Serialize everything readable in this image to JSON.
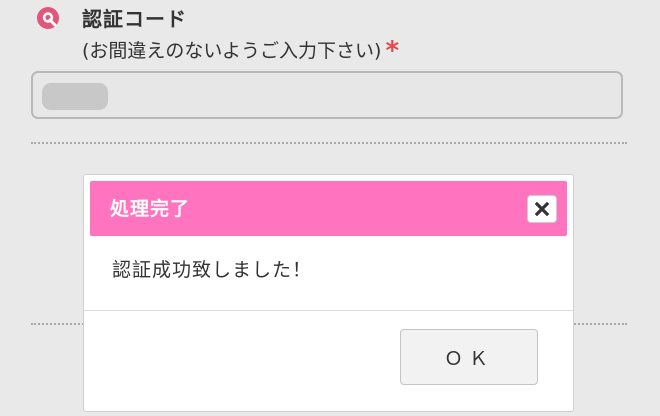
{
  "form": {
    "title": "認証コード",
    "note": "(お間違えのないようご入力下さい)",
    "required_mark": "*"
  },
  "dialog": {
    "title": "処理完了",
    "message": "認証成功致しました！",
    "ok_label": "ＯＫ",
    "close_icon": "close-icon"
  },
  "colors": {
    "header": "#ff73bf",
    "required": "#e8484a",
    "brand_icon": "#e0577b"
  }
}
